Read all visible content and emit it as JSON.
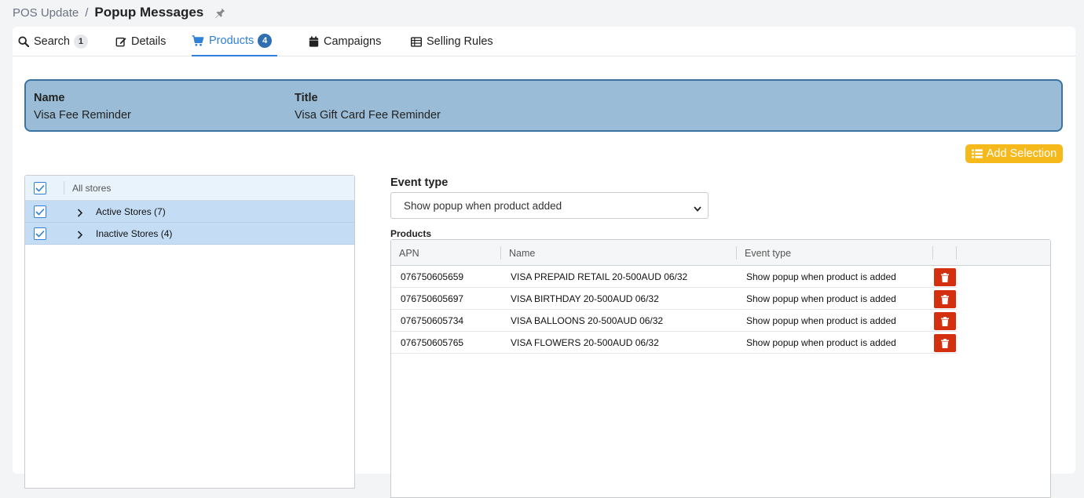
{
  "breadcrumb": {
    "parent": "POS Update",
    "separator": "/",
    "current": "Popup Messages"
  },
  "tabs": [
    {
      "label": "Search",
      "badge": "1"
    },
    {
      "label": "Details"
    },
    {
      "label": "Products",
      "badge": "4"
    },
    {
      "label": "Campaigns"
    },
    {
      "label": "Selling Rules"
    }
  ],
  "info": {
    "name_label": "Name",
    "name_value": "Visa Fee Reminder",
    "title_label": "Title",
    "title_value": "Visa Gift Card Fee Reminder"
  },
  "add_selection_label": "Add Selection",
  "store_tree": {
    "header": "All stores",
    "rows": [
      {
        "label": "Active Stores (7)"
      },
      {
        "label": "Inactive Stores (4)"
      }
    ]
  },
  "event_type": {
    "label": "Event type",
    "selected": "Show popup when product added"
  },
  "products": {
    "label": "Products",
    "columns": [
      "APN",
      "Name",
      "Event type"
    ],
    "rows": [
      {
        "apn": "076750605659",
        "name": "VISA PREPAID RETAIL 20-500AUD 06/32",
        "event": "Show popup when product is added"
      },
      {
        "apn": "076750605697",
        "name": "VISA BIRTHDAY 20-500AUD 06/32",
        "event": "Show popup when product is added"
      },
      {
        "apn": "076750605734",
        "name": "VISA BALLOONS 20-500AUD 06/32",
        "event": "Show popup when product is added"
      },
      {
        "apn": "076750605765",
        "name": "VISA FLOWERS 20-500AUD 06/32",
        "event": "Show popup when product is added"
      }
    ]
  },
  "colors": {
    "accent": "#2f80d8",
    "info_bg": "#9abcd6",
    "add_button": "#f6b91b",
    "delete_button": "#d4300f",
    "row_selected": "#c4ddf5"
  }
}
